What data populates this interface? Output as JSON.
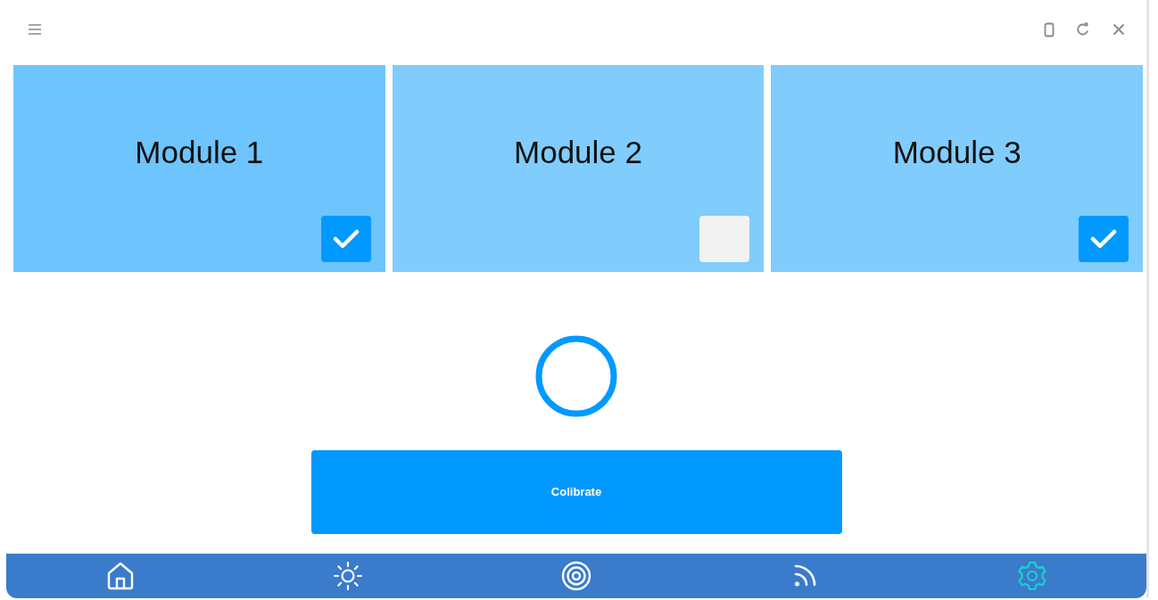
{
  "modules": [
    {
      "label": "Module 1",
      "selected": true,
      "checked": true
    },
    {
      "label": "Module 2",
      "selected": false,
      "checked": false
    },
    {
      "label": "Module 3",
      "selected": false,
      "checked": true
    }
  ],
  "action": {
    "label": "Colibrate"
  },
  "nav": [
    {
      "kind": "home",
      "selected": false
    },
    {
      "kind": "sun",
      "selected": false
    },
    {
      "kind": "target",
      "selected": false
    },
    {
      "kind": "signal",
      "selected": false
    },
    {
      "kind": "settings",
      "selected": true
    }
  ]
}
